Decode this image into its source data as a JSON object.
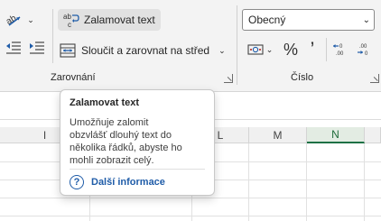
{
  "ribbon": {
    "alignment": {
      "wrap_text_label": "Zalamovat text",
      "merge_center_label": "Sloučit a zarovnat na střed",
      "group_label": "Zarovnání"
    },
    "number": {
      "format_value": "Obecný",
      "group_label": "Číslo"
    }
  },
  "grid": {
    "columns": [
      "I",
      "L",
      "M",
      "N"
    ],
    "active_column": "N"
  },
  "tooltip": {
    "title": "Zalamovat text",
    "description": "Umožňuje zalomit obzvlášť dlouhý text do několika řádků, abyste ho mohli zobrazit celý.",
    "help_symbol": "?",
    "more_info_link": "Další informace"
  },
  "icons": {
    "orientation": "orientation-icon",
    "decrease_indent": "decrease-indent-icon",
    "increase_indent": "increase-indent-icon",
    "wrap_text": "wrap-text-icon",
    "merge": "merge-center-icon",
    "accounting": "accounting-format-icon",
    "percent": "percent-icon",
    "comma": "comma-style-icon",
    "increase_decimal": "increase-decimal-icon",
    "decrease_decimal": "decrease-decimal-icon",
    "help": "help-icon",
    "dialog_launcher": "dialog-launcher-icon"
  },
  "colors": {
    "accent_green": "#1e7145",
    "link_blue": "#1f5ca8",
    "ribbon_bg": "#f3f3f3"
  }
}
